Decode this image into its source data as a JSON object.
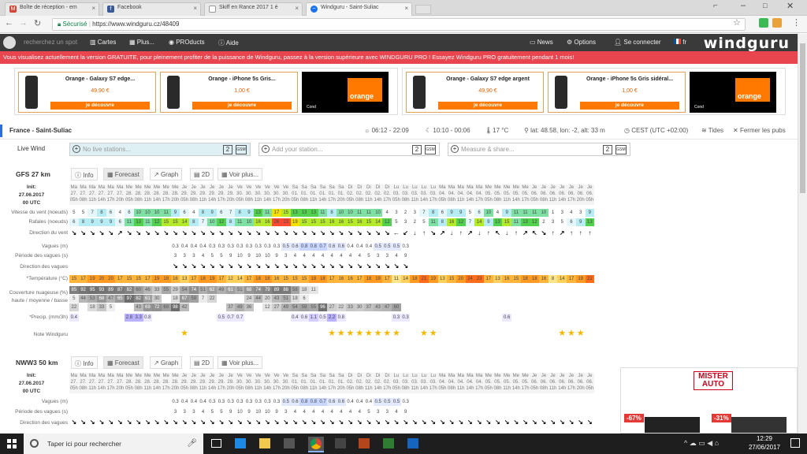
{
  "browser": {
    "tabs": [
      {
        "label": "Boîte de réception - em",
        "icon": "gmail-icon"
      },
      {
        "label": "Facebook",
        "icon": "facebook-icon"
      },
      {
        "label": "Skiff en Rance 2017 1 é",
        "icon": "page-icon"
      },
      {
        "label": "Windguru - Saint-Suliac",
        "icon": "windguru-icon"
      }
    ],
    "secure_label": "Sécurisé",
    "url": "https://www.windguru.cz/48409"
  },
  "site": {
    "search_placeholder": "recherchez un spot",
    "nav": [
      "Cartes",
      "Plus...",
      "PROducts",
      "Aide"
    ],
    "right": [
      "News",
      "Options",
      "Se connecter",
      "fr"
    ],
    "logo": "windguru",
    "banner": "Vous visualisez actuellement la version GRATUITE, pour pleinement profiter de la puissance de Windguru, passez à la version supérieure avec WINDGURU PRO ! Essayez Windguru PRO gratuitement pendant 1 mois!"
  },
  "ads": [
    {
      "title": "Orange - Galaxy S7 edge...",
      "price": "49,90 €",
      "cta": "je découvre"
    },
    {
      "title": "Orange - iPhone 5s Gris...",
      "price": "1,00 €",
      "cta": "je découvre"
    },
    {
      "title": "Orange - Galaxy S7 edge argent",
      "price": "49,90 €",
      "cta": "je découvre"
    },
    {
      "title": "Orange - iPhone 5s Gris sidéral...",
      "price": "1,00 €",
      "cta": "je découvre"
    }
  ],
  "orange": {
    "brand": "orange",
    "note": "Conditions consultables sur orange.fr"
  },
  "location": {
    "name": "France - Saint-Suliac",
    "sun": "06:12 - 22:09",
    "moon": "10:10 - 00:06",
    "temp": "17 °C",
    "coords": "lat: 48.58, lon: -2, alt: 33 m",
    "tz": "CEST (UTC +02:00)",
    "tides": "Tides",
    "close": "Fermer les pubs"
  },
  "live": {
    "label": "Live Wind",
    "boxes": [
      {
        "text": "No live stations...",
        "num": "2",
        "gsm": "GSM"
      },
      {
        "text": "Add your station...",
        "num": "2",
        "gsm": "GSM"
      },
      {
        "text": "Measure & share...",
        "num": "2",
        "gsm": "GSM"
      }
    ]
  },
  "gfs": {
    "name": "GFS 27 km",
    "tabs": [
      "Info",
      "Forecast",
      "Graph",
      "2D",
      "Voir plus..."
    ],
    "init_label": "Init:",
    "init_date": "27.06.2017",
    "init_time": "00 UTC",
    "labels": [
      "Vitesse du vent (noeuds)",
      "Rafales (noeuds)",
      "Direction du vent",
      "Vagues (m)",
      "Période des vagues (s)",
      "Direction des vagues",
      "*Température (°C)",
      "Couverture nuageuse (%)",
      "haute / moyenne / basse",
      "*Precip. (mm/3h)",
      "Note Windguru"
    ],
    "days": [
      "Ma",
      "Ma",
      "Ma",
      "Ma",
      "Ma",
      "Ma",
      "Me",
      "Me",
      "Me",
      "Me",
      "Me",
      "Me",
      "Je",
      "Je",
      "Je",
      "Je",
      "Je",
      "Je",
      "Ve",
      "Ve",
      "Ve",
      "Ve",
      "Ve",
      "Ve",
      "Sa",
      "Sa",
      "Sa",
      "Sa",
      "Sa",
      "Sa",
      "Di",
      "Di",
      "Di",
      "Di",
      "Di",
      "Lu",
      "Lu",
      "Lu",
      "Lu",
      "Lu",
      "Ma",
      "Ma",
      "Ma",
      "Ma",
      "Ma",
      "Me",
      "Me",
      "Me",
      "Me",
      "Me",
      "Je",
      "Je",
      "Je",
      "Je",
      "Je",
      "Je",
      "Je"
    ],
    "dates": [
      "27.",
      "27.",
      "27.",
      "27.",
      "27.",
      "27.",
      "28.",
      "28.",
      "28.",
      "28.",
      "28.",
      "28.",
      "29.",
      "29.",
      "29.",
      "29.",
      "29.",
      "29.",
      "30.",
      "30.",
      "30.",
      "30.",
      "30.",
      "30.",
      "01.",
      "01.",
      "01.",
      "01.",
      "01.",
      "01.",
      "02.",
      "02.",
      "02.",
      "02.",
      "02.",
      "03.",
      "03.",
      "03.",
      "03.",
      "03.",
      "04.",
      "04.",
      "04.",
      "04.",
      "04.",
      "05.",
      "05.",
      "05.",
      "05.",
      "05.",
      "06.",
      "06.",
      "06.",
      "06.",
      "06.",
      "06.",
      "06."
    ],
    "hours": [
      "05h",
      "08h",
      "11h",
      "14h",
      "17h",
      "20h",
      "05h",
      "08h",
      "11h",
      "14h",
      "17h",
      "20h",
      "05h",
      "08h",
      "11h",
      "14h",
      "17h",
      "20h",
      "05h",
      "08h",
      "11h",
      "14h",
      "17h",
      "20h",
      "05h",
      "08h",
      "11h",
      "14h",
      "17h",
      "20h",
      "05h",
      "08h",
      "11h",
      "14h",
      "17h",
      "05h",
      "08h",
      "11h",
      "14h",
      "17h",
      "05h",
      "08h",
      "11h",
      "14h",
      "17h",
      "05h",
      "08h",
      "11h",
      "14h",
      "17h",
      "05h",
      "08h",
      "11h",
      "14h",
      "17h",
      "20h",
      "05h"
    ],
    "wind": [
      5,
      5,
      7,
      8,
      6,
      4,
      6,
      10,
      10,
      10,
      11,
      9,
      6,
      4,
      8,
      9,
      6,
      7,
      8,
      9,
      13,
      11,
      17,
      15,
      13,
      13,
      13,
      11,
      8,
      10,
      10,
      11,
      11,
      10,
      4,
      3,
      2,
      3,
      7,
      8,
      6,
      9,
      9,
      5,
      6,
      10,
      4,
      9,
      11,
      11,
      11,
      10,
      1,
      3,
      4,
      3,
      9
    ],
    "gusts": [
      6,
      8,
      9,
      9,
      9,
      6,
      11,
      13,
      11,
      12,
      15,
      15,
      14,
      8,
      7,
      10,
      12,
      8,
      11,
      10,
      16,
      16,
      26,
      23,
      19,
      15,
      15,
      15,
      16,
      16,
      15,
      16,
      15,
      14,
      12,
      5,
      3,
      2,
      5,
      11,
      8,
      16,
      12,
      7,
      14,
      9,
      13,
      15,
      11,
      13,
      12,
      2,
      3,
      5,
      6,
      9,
      13
    ],
    "dirs": [
      "↘",
      "↘",
      "↘",
      "↘",
      "↘",
      "↗",
      "↘",
      "↘",
      "↘",
      "↘",
      "↘",
      "↘",
      "↘",
      "↘",
      "↘",
      "↘",
      "↘",
      "↘",
      "↘",
      "↘",
      "↘",
      "↘",
      "↘",
      "↘",
      "↘",
      "↘",
      "↘",
      "↘",
      "↘",
      "↘",
      "↘",
      "↘",
      "↘",
      "↘",
      "↘",
      "←",
      "↙",
      "↓",
      "↑",
      "↘",
      "↗",
      "↓",
      "↑",
      "↗",
      "↓",
      "↑",
      "↖",
      "↓",
      "↑",
      "↗",
      "↖",
      "↘",
      "↑",
      "↗",
      "↑",
      "↑",
      "↑"
    ],
    "waves": [
      "0.3",
      "0.4",
      "0.4",
      "0.4",
      "0.3",
      "0.3",
      "0.3",
      "0.3",
      "0.3",
      "0.3",
      "0.3",
      "0.3",
      "0.5",
      "0.6",
      "0.8",
      "0.8",
      "0.7",
      "0.6",
      "0.6",
      "0.4",
      "0.4",
      "0.4",
      "0.5",
      "0.5",
      "0.5",
      "0.3"
    ],
    "periods": [
      "3",
      "3",
      "3",
      "4",
      "5",
      "5",
      "9",
      "10",
      "9",
      "10",
      "10",
      "9",
      "3",
      "4",
      "4",
      "4",
      "4",
      "4",
      "4",
      "4",
      "4",
      "5",
      "3",
      "3",
      "4",
      "9"
    ],
    "temps": [
      15,
      17,
      19,
      20,
      20,
      17,
      15,
      15,
      17,
      19,
      18,
      16,
      13,
      17,
      18,
      19,
      17,
      12,
      14,
      17,
      18,
      18,
      16,
      15,
      15,
      15,
      18,
      18,
      17,
      16,
      16,
      17,
      18,
      19,
      17,
      11,
      14,
      18,
      21,
      19,
      13,
      15,
      20,
      24,
      23,
      17,
      13,
      16,
      15,
      18,
      18,
      16,
      8,
      14,
      17,
      19,
      22
    ],
    "cloud_top": [
      85,
      92,
      95,
      93,
      89,
      87,
      82,
      60,
      46,
      33,
      55,
      29,
      54,
      74,
      51,
      62,
      49,
      61,
      51,
      68,
      74,
      79,
      89,
      88,
      58,
      18,
      11,
      "",
      "",
      "",
      "",
      "",
      "",
      "",
      "",
      "",
      "",
      "",
      "",
      "",
      "",
      "",
      "",
      "",
      "",
      "",
      "",
      "",
      "",
      "",
      "",
      "",
      "",
      "",
      "",
      "",
      ""
    ],
    "cloud_mid": [
      5,
      44,
      53,
      68,
      47,
      65,
      97,
      82,
      61,
      30,
      "",
      18,
      67,
      59,
      7,
      22,
      "",
      "",
      "",
      24,
      44,
      20,
      43,
      51,
      18,
      6,
      "",
      "",
      "",
      "",
      "",
      "",
      "",
      "",
      "",
      "",
      "",
      "",
      "",
      "",
      "",
      "",
      "",
      "",
      "",
      "",
      "",
      "",
      "",
      "",
      "",
      "",
      "",
      "",
      "",
      ""
    ],
    "cloud_low": [
      22,
      "",
      18,
      33,
      5,
      "",
      "",
      43,
      69,
      72,
      60,
      98,
      42,
      "",
      "",
      "",
      "",
      37,
      49,
      36,
      "",
      12,
      27,
      49,
      54,
      59,
      55,
      96,
      27,
      22,
      33,
      30,
      37,
      43,
      47,
      60,
      "",
      "",
      "",
      "",
      "",
      "",
      "",
      "",
      "",
      "",
      "",
      "",
      "",
      "",
      "",
      "",
      "",
      "",
      "",
      "",
      ""
    ],
    "precip": [
      "0.4",
      "",
      "",
      "",
      "",
      "",
      "2.8",
      "3.3",
      "0.8",
      "",
      "",
      "",
      "",
      "",
      "",
      "",
      "0.5",
      "0.7",
      "0.7",
      "",
      "",
      "",
      "",
      "",
      "0.4",
      "0.6",
      "1.1",
      "0.5",
      "2.2",
      "0.8",
      "",
      "",
      "",
      "",
      "",
      "0.3",
      "0.3",
      "",
      "",
      "",
      "",
      "",
      "",
      "",
      "",
      "",
      "",
      "0.6",
      "",
      "",
      "",
      "",
      "",
      "",
      "",
      "",
      ""
    ],
    "stars": [
      0,
      0,
      0,
      0,
      0,
      0,
      0,
      0,
      0,
      0,
      0,
      0,
      1,
      0,
      0,
      0,
      0,
      0,
      0,
      0,
      0,
      0,
      0,
      0,
      0,
      0,
      0,
      0,
      1,
      1,
      2,
      1,
      1,
      1,
      1,
      1,
      0,
      0,
      1,
      1,
      0,
      0,
      0,
      0,
      0,
      0,
      0,
      0,
      0,
      0,
      0,
      0,
      0,
      1,
      1,
      1,
      0
    ]
  },
  "nww3": {
    "name": "NWW3 50 km",
    "tabs": [
      "Info",
      "Forecast",
      "Graph",
      "2D",
      "Voir plus..."
    ],
    "init_label": "Init:",
    "init_date": "27.06.2017",
    "init_time": "00 UTC",
    "labels": [
      "Vagues (m)",
      "Période des vagues (s)",
      "Direction des vagues"
    ],
    "waves": [
      "0.3",
      "0.4",
      "0.4",
      "0.4",
      "0.3",
      "0.3",
      "0.3",
      "0.3",
      "0.3",
      "0.3",
      "0.3",
      "0.3",
      "0.5",
      "0.6",
      "0.8",
      "0.8",
      "0.7",
      "0.6",
      "0.6",
      "0.4",
      "0.4",
      "0.4",
      "0.5",
      "0.5",
      "0.5",
      "0.3"
    ],
    "periods": [
      "3",
      "3",
      "3",
      "4",
      "5",
      "5",
      "9",
      "10",
      "9",
      "10",
      "10",
      "9",
      "3",
      "4",
      "4",
      "4",
      "4",
      "4",
      "4",
      "4",
      "4",
      "5",
      "3",
      "3",
      "4",
      "9"
    ]
  },
  "mister": {
    "brand": "MISTER AUTO",
    "badges": [
      "-67%",
      "-31%"
    ]
  },
  "taskbar": {
    "search": "Taper ici pour rechercher",
    "time": "12:29",
    "date": "27/06/2017"
  }
}
